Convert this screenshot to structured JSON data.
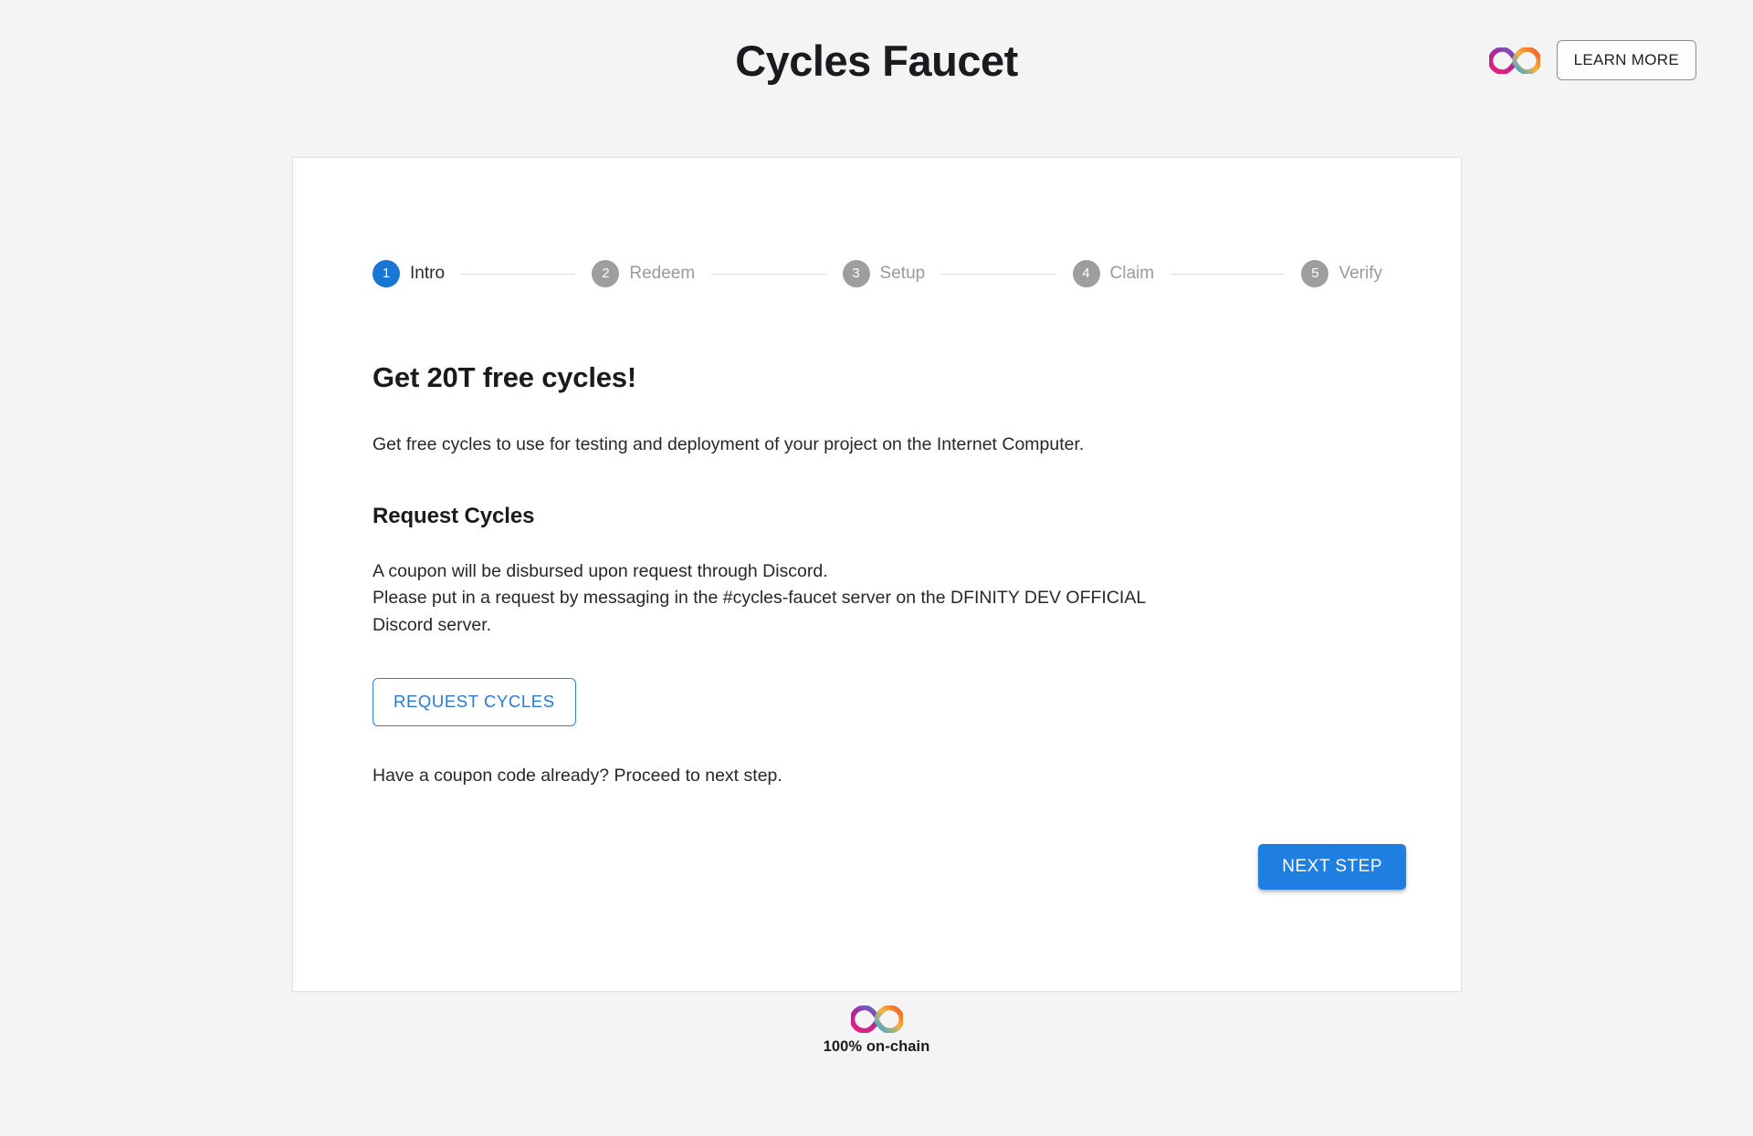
{
  "header": {
    "title": "Cycles Faucet",
    "logo_icon": "dfinity-infinity-logo",
    "learn_more_label": "LEARN MORE"
  },
  "stepper": {
    "active_index": 1,
    "steps": [
      {
        "number": "1",
        "label": "Intro",
        "state": "active"
      },
      {
        "number": "2",
        "label": "Redeem",
        "state": "inactive"
      },
      {
        "number": "3",
        "label": "Setup",
        "state": "inactive"
      },
      {
        "number": "4",
        "label": "Claim",
        "state": "inactive"
      },
      {
        "number": "5",
        "label": "Verify",
        "state": "inactive"
      }
    ]
  },
  "main": {
    "heading": "Get 20T free cycles!",
    "intro_paragraph": "Get free cycles to use for testing and deployment of your project on the Internet Computer.",
    "section_heading": "Request Cycles",
    "request_line_1": "A coupon will be disbursed upon request through Discord.",
    "request_line_2": "Please put in a request by messaging in the #cycles-faucet server on the DFINITY DEV OFFICIAL Discord server.",
    "request_cycles_label": "REQUEST CYCLES",
    "coupon_hint": "Have a coupon code already? Proceed to next step.",
    "next_step_label": "NEXT STEP"
  },
  "footer": {
    "logo_icon": "dfinity-infinity-logo",
    "tagline": "100% on-chain"
  },
  "colors": {
    "page_background": "#f4f4f4",
    "card_background": "#ffffff",
    "accent_blue": "#1976d2",
    "next_button_blue": "#1f7fe0",
    "request_button_blue": "#2978d8",
    "step_inactive_gray": "#9e9e9e",
    "text_primary": "#1b1b1f",
    "text_muted": "#9a9a9a",
    "logo_purple": "#8b2ba0",
    "logo_magenta": "#ec1e79",
    "logo_cyan": "#29abe2",
    "logo_orange": "#f15a24"
  }
}
